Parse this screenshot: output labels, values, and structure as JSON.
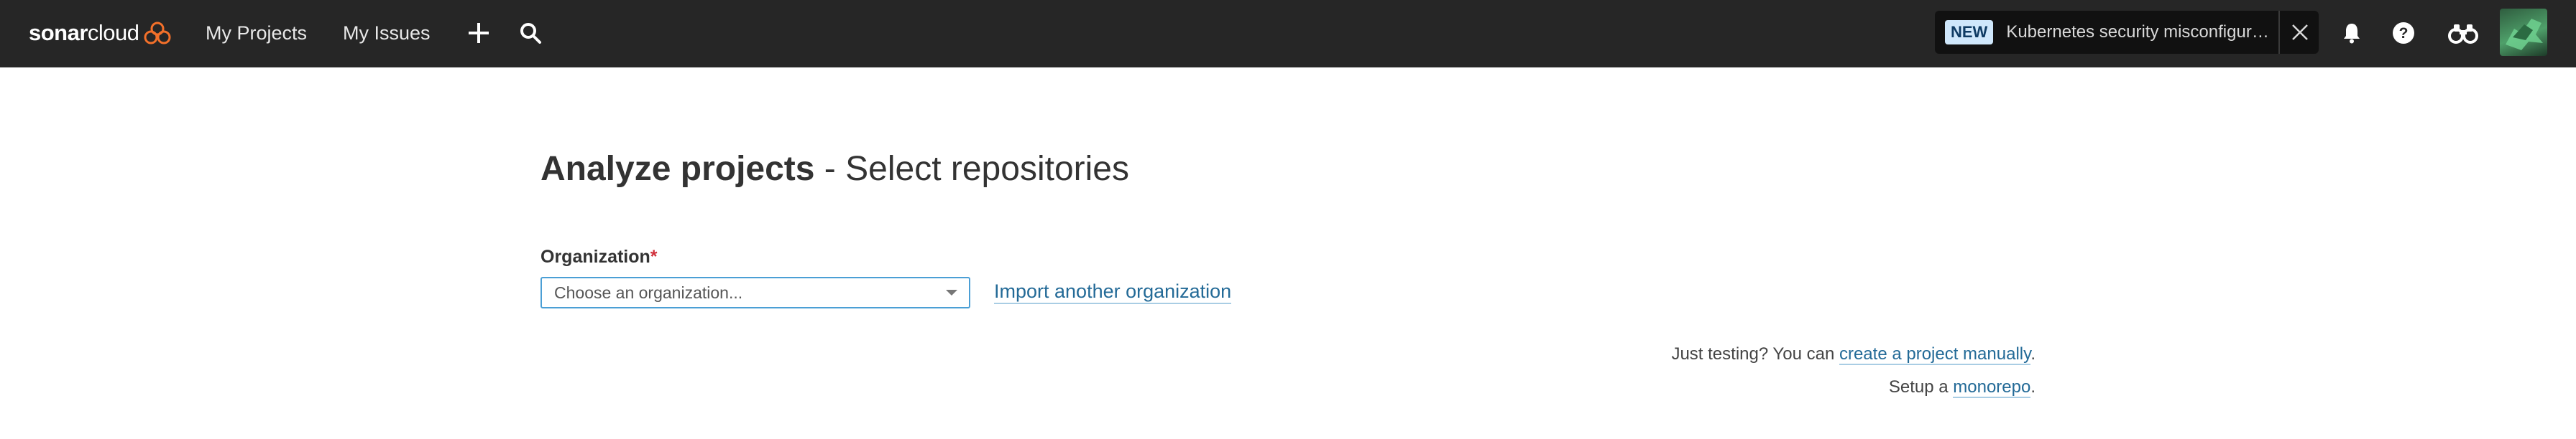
{
  "header": {
    "logo": {
      "bold": "sonar",
      "regular": "cloud"
    },
    "nav": [
      {
        "label": "My Projects"
      },
      {
        "label": "My Issues"
      }
    ],
    "promo": {
      "badge": "NEW",
      "text": "Kubernetes security misconfigurations"
    },
    "icons": [
      "plus-icon",
      "search-icon",
      "close-icon",
      "bell-icon",
      "help-icon",
      "binoculars-icon"
    ]
  },
  "main": {
    "title_strong": "Analyze projects",
    "title_rest": " - Select repositories",
    "organization_label": "Organization",
    "required_mark": "*",
    "organization_placeholder": "Choose an organization...",
    "import_link": "Import another organization",
    "testing_prefix": "Just testing? You can ",
    "testing_link": "create a project manually",
    "testing_suffix": ".",
    "monorepo_prefix": "Setup a ",
    "monorepo_link": "monorepo",
    "monorepo_suffix": "."
  },
  "colors": {
    "topbar": "#262626",
    "link": "#236a97",
    "select_border": "#4b9fd5",
    "required": "#d02f3a",
    "logo_accent": "#f3702a"
  }
}
